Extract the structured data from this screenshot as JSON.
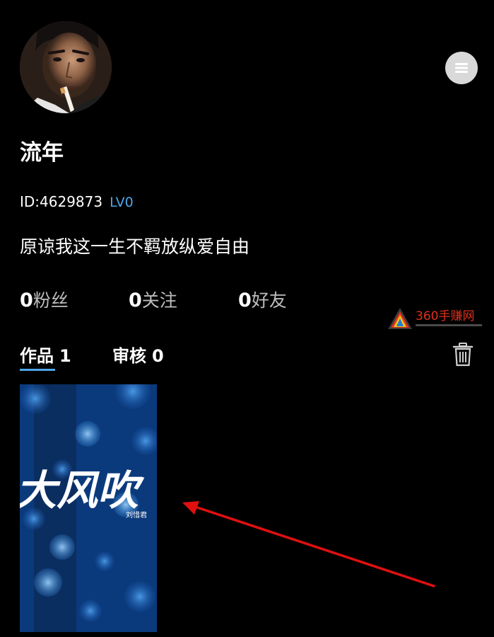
{
  "profile": {
    "nickname": "流年",
    "id_label": "ID:4629873",
    "level": "LV0",
    "signature": "原谅我这一生不羁放纵爱自由"
  },
  "stats": {
    "fans": {
      "value": "0",
      "label": "粉丝"
    },
    "following": {
      "value": "0",
      "label": "关注"
    },
    "friends": {
      "value": "0",
      "label": "好友"
    }
  },
  "tabs": [
    {
      "label": "作品",
      "count": "1",
      "active": true
    },
    {
      "label": "审核",
      "count": "0",
      "active": false
    }
  ],
  "works": [
    {
      "title": "大风吹",
      "artist": "刘惜君"
    }
  ],
  "watermark": {
    "text": "360手赚网"
  },
  "icons": {
    "menu": "menu-icon",
    "delete": "trash-icon"
  },
  "colors": {
    "background": "#000000",
    "accent": "#4ea6e8",
    "annotation_arrow": "#e01010",
    "watermark": "#e0301e"
  }
}
